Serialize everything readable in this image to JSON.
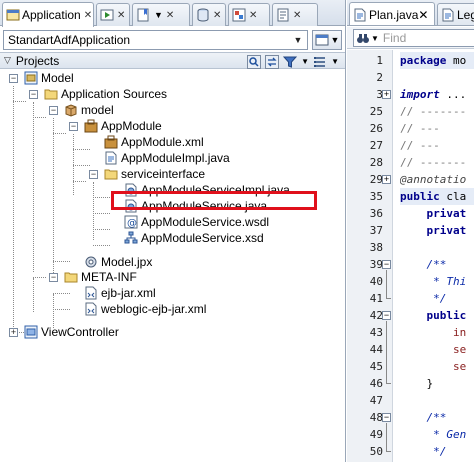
{
  "left_tabs": [
    {
      "label": "Application",
      "icon": "application-navigator-icon",
      "active": true
    },
    {
      "label": "",
      "icon": "run-manager-icon"
    },
    {
      "label": "",
      "icon": "bookmarks-icon"
    },
    {
      "label": "",
      "icon": "database-navigator-icon"
    },
    {
      "label": "",
      "icon": "resource-palette-icon"
    },
    {
      "label": "",
      "icon": "log-icon"
    }
  ],
  "application_selector": {
    "value": "StandartAdfApplication"
  },
  "projects_panel": {
    "title": "Projects"
  },
  "tree": [
    {
      "label": "Model",
      "icon": "project-icon",
      "level": 0,
      "toggle": "-"
    },
    {
      "label": "Application Sources",
      "icon": "folder-icon",
      "level": 1,
      "toggle": "-"
    },
    {
      "label": "model",
      "icon": "package-icon",
      "level": 2,
      "toggle": "-"
    },
    {
      "label": "AppModule",
      "icon": "application-module-icon",
      "level": 3,
      "toggle": "-"
    },
    {
      "label": "AppModule.xml",
      "icon": "xml-file-icon",
      "level": 4,
      "toggle": ""
    },
    {
      "label": "AppModuleImpl.java",
      "icon": "java-file-icon",
      "level": 4,
      "toggle": ""
    },
    {
      "label": "serviceinterface",
      "icon": "folder-icon",
      "level": 4,
      "toggle": "-"
    },
    {
      "label": "AppModuleServiceImpl.java",
      "icon": "java-file-icon",
      "level": 5,
      "toggle": "",
      "highlighted": true
    },
    {
      "label": "AppModuleService.java",
      "icon": "java-file-icon",
      "level": 5,
      "toggle": ""
    },
    {
      "label": "AppModuleService.wsdl",
      "icon": "wsdl-file-icon",
      "level": 5,
      "toggle": ""
    },
    {
      "label": "AppModuleService.xsd",
      "icon": "xsd-file-icon",
      "level": 5,
      "toggle": ""
    },
    {
      "label": "Model.jpx",
      "icon": "jpx-file-icon",
      "level": 2,
      "toggle": ""
    },
    {
      "label": "META-INF",
      "icon": "folder-icon",
      "level": 1,
      "toggle": "-"
    },
    {
      "label": "ejb-jar.xml",
      "icon": "xml-file-icon",
      "level": 2,
      "toggle": ""
    },
    {
      "label": "weblogic-ejb-jar.xml",
      "icon": "xml-file-icon",
      "level": 2,
      "toggle": ""
    },
    {
      "label": "ViewController",
      "icon": "project-icon",
      "level": 0,
      "toggle": "+"
    }
  ],
  "right_tabs": [
    {
      "label": "Plan.java",
      "active": true
    },
    {
      "label": "Leg",
      "active": false
    }
  ],
  "find": {
    "placeholder": "Find"
  },
  "editor": {
    "lines": [
      {
        "n": "1",
        "text": "package mo",
        "style": "pkg",
        "fold": ""
      },
      {
        "n": "2",
        "text": "",
        "style": "",
        "fold": ""
      },
      {
        "n": "3",
        "text": "import ...",
        "style": "imp",
        "fold": "+"
      },
      {
        "n": "25",
        "text": "// -------",
        "style": "cmt",
        "fold": ""
      },
      {
        "n": "26",
        "text": "// ---",
        "style": "cmt",
        "fold": ""
      },
      {
        "n": "27",
        "text": "// ---",
        "style": "cmt",
        "fold": ""
      },
      {
        "n": "28",
        "text": "// -------",
        "style": "cmt",
        "fold": ""
      },
      {
        "n": "29",
        "text": "@annotatio",
        "style": "ann",
        "fold": "+"
      },
      {
        "n": "35",
        "text": "public cla",
        "style": "cls",
        "fold": ""
      },
      {
        "n": "36",
        "text": "    privat",
        "style": "priv",
        "fold": ""
      },
      {
        "n": "37",
        "text": "    privat",
        "style": "priv",
        "fold": ""
      },
      {
        "n": "38",
        "text": "",
        "style": "",
        "fold": ""
      },
      {
        "n": "39",
        "text": "    /**",
        "style": "jd",
        "fold": "-"
      },
      {
        "n": "40",
        "text": "     * Thi",
        "style": "jd",
        "fold": ""
      },
      {
        "n": "41",
        "text": "     */",
        "style": "jd",
        "fold": ""
      },
      {
        "n": "42",
        "text": "    public",
        "style": "pub",
        "fold": "-"
      },
      {
        "n": "43",
        "text": "        in",
        "style": "fld",
        "fold": ""
      },
      {
        "n": "44",
        "text": "        se",
        "style": "fld",
        "fold": ""
      },
      {
        "n": "45",
        "text": "        se",
        "style": "fld",
        "fold": ""
      },
      {
        "n": "46",
        "text": "    }",
        "style": "",
        "fold": ""
      },
      {
        "n": "47",
        "text": "",
        "style": "",
        "fold": ""
      },
      {
        "n": "48",
        "text": "    /**",
        "style": "jd",
        "fold": "-"
      },
      {
        "n": "49",
        "text": "     * Gen",
        "style": "jd",
        "fold": ""
      },
      {
        "n": "50",
        "text": "     */",
        "style": "jd",
        "fold": ""
      }
    ]
  },
  "colors": {
    "highlight_border": "#e0101b",
    "keyword": "#00008b",
    "javadoc": "#0b2aa8",
    "comment": "#777777"
  }
}
